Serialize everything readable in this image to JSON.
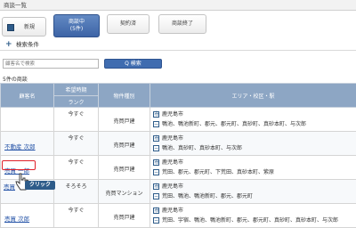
{
  "window": {
    "title": "商談一覧"
  },
  "tabs": {
    "new_label": "新規",
    "active_line1": "商談中",
    "active_line2": "(5件)",
    "contract_label": "契約済",
    "done_label": "商談終了"
  },
  "conditions": {
    "icon": "plus-icon",
    "label": "検索条件"
  },
  "search": {
    "placeholder": "顧客名で検索",
    "button_label": "Q 検索"
  },
  "count_text": "5件の商談",
  "table": {
    "headers": {
      "customer": "顧客名",
      "timing": "希望時期",
      "rank": "ランク",
      "type": "物件種別",
      "area": "エリア・校区・駅"
    },
    "rows": [
      {
        "name": "",
        "timing": "今すぐ",
        "type": "売買戸建",
        "area": [
          "鹿児島市",
          "鴨池、鴨池新町、郡元、郡元町、真砂町、真砂本町、与次郎"
        ]
      },
      {
        "name": "不動産 次郎",
        "timing": "今すぐ",
        "type": "売買戸建",
        "area": [
          "鹿児島市",
          "鴨池、真砂町、真砂本町、与次郎"
        ]
      },
      {
        "name": "売買 一郎",
        "timing": "今すぐ",
        "type": "売買戸建",
        "area": [
          "鹿児島市",
          "荒田、郡元、郡元町、下荒田、真砂本町、紫原"
        ]
      },
      {
        "name": "",
        "timing": "そろそろ",
        "type": "売買マンション",
        "area": [
          "鹿児島市",
          "荒田、鴨池、鴨池新町、郡元、郡元町"
        ]
      },
      {
        "name": "売買 次郎",
        "timing": "今すぐ",
        "type": "売買戸建",
        "area": [
          "鹿児島市",
          "荒田、宇宿、鴨池、鴨池新町、郡元、郡元町、真砂町、真砂本町、与次郎"
        ]
      }
    ]
  },
  "overlay": {
    "click_label": "クリック",
    "ghost_name": "売買"
  },
  "colors": {
    "header_bg": "#8da6c4",
    "active_tab": "#3d64a6",
    "highlight": "#e0202a",
    "link": "#2251a6"
  }
}
